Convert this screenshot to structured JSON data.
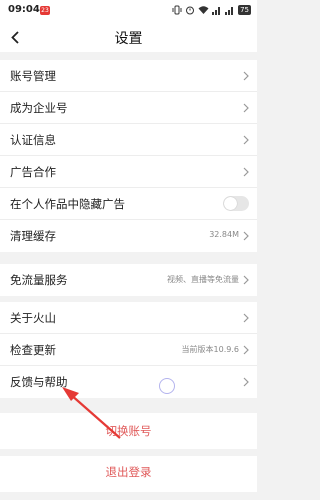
{
  "status_bar": {
    "time": "09:04",
    "notification_badge": "23",
    "battery": "75"
  },
  "header": {
    "title": "设置",
    "back_icon": "chevron-left-icon"
  },
  "section1": [
    {
      "label": "账号管理"
    },
    {
      "label": "成为企业号"
    },
    {
      "label": "认证信息"
    },
    {
      "label": "广告合作"
    },
    {
      "label": "在个人作品中隐藏广告",
      "toggle": false
    },
    {
      "label": "清理缓存",
      "value": "32.84M"
    }
  ],
  "section2": [
    {
      "label": "免流量服务",
      "value": "视频、直播等免流量"
    }
  ],
  "section3": [
    {
      "label": "关于火山"
    },
    {
      "label": "检查更新",
      "value": "当前版本10.9.6"
    },
    {
      "label": "反馈与帮助"
    }
  ],
  "actions": {
    "switch_account": "切换账号",
    "logout": "退出登录"
  },
  "colors": {
    "accent_red": "#e05a5a",
    "arrow_red": "#e53935"
  }
}
